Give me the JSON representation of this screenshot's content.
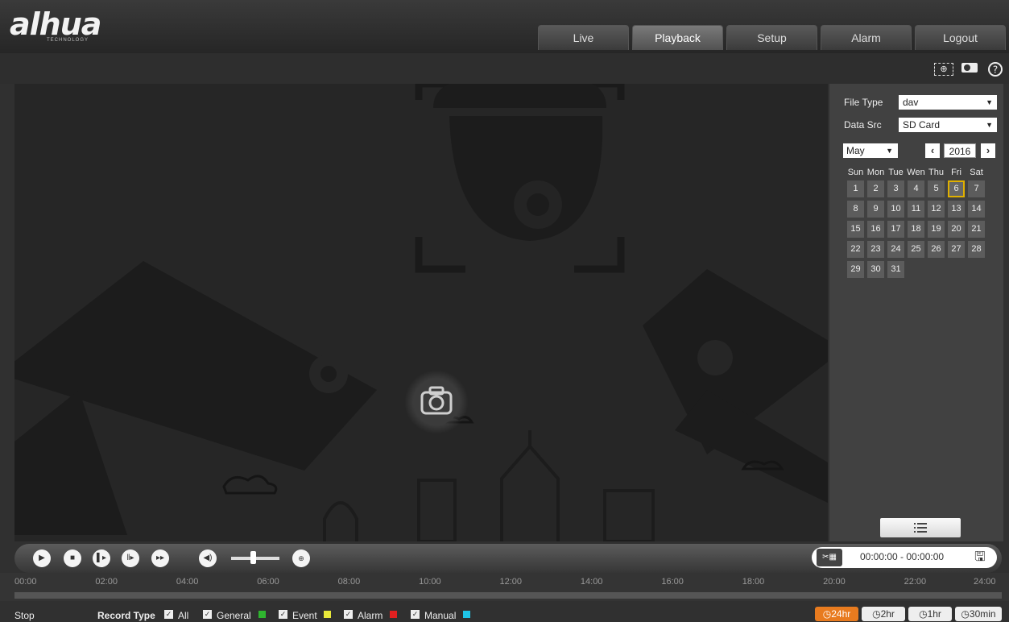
{
  "header": {
    "logo": "alhua",
    "logo_sub": "TECHNOLOGY",
    "nav": [
      "Live",
      "Playback",
      "Setup",
      "Alarm",
      "Logout"
    ],
    "active_tab": "Playback"
  },
  "toolbar": {
    "icons": [
      "region-zoom-icon",
      "snapshot-toggle-icon",
      "help-icon"
    ]
  },
  "side": {
    "file_type_label": "File Type",
    "file_type_value": "dav",
    "data_src_label": "Data Src",
    "data_src_value": "SD Card",
    "month": "May",
    "year": "2016",
    "weekdays": [
      "Sun",
      "Mon",
      "Tue",
      "Wen",
      "Thu",
      "Fri",
      "Sat"
    ],
    "days": [
      "1",
      "2",
      "3",
      "4",
      "5",
      "6",
      "7",
      "8",
      "9",
      "10",
      "11",
      "12",
      "13",
      "14",
      "15",
      "16",
      "17",
      "18",
      "19",
      "20",
      "21",
      "22",
      "23",
      "24",
      "25",
      "26",
      "27",
      "28",
      "29",
      "30",
      "31"
    ],
    "today": "6",
    "first_weekday_offset": 0
  },
  "controls": {
    "time_range": "00:00:00 - 00:00:00",
    "volume_level": 0.45
  },
  "timeline": {
    "ticks": [
      "00:00",
      "02:00",
      "04:00",
      "06:00",
      "08:00",
      "10:00",
      "12:00",
      "14:00",
      "16:00",
      "18:00",
      "20:00",
      "22:00",
      "24:00"
    ]
  },
  "status": {
    "state": "Stop",
    "record_type_label": "Record Type",
    "types": [
      {
        "label": "All",
        "color": ""
      },
      {
        "label": "General",
        "color": "#2fb52f"
      },
      {
        "label": "Event",
        "color": "#e8e83a"
      },
      {
        "label": "Alarm",
        "color": "#e02020"
      },
      {
        "label": "Manual",
        "color": "#1fc5e8"
      }
    ],
    "zoom": [
      "24hr",
      "2hr",
      "1hr",
      "30min"
    ],
    "active_zoom": "24hr"
  }
}
